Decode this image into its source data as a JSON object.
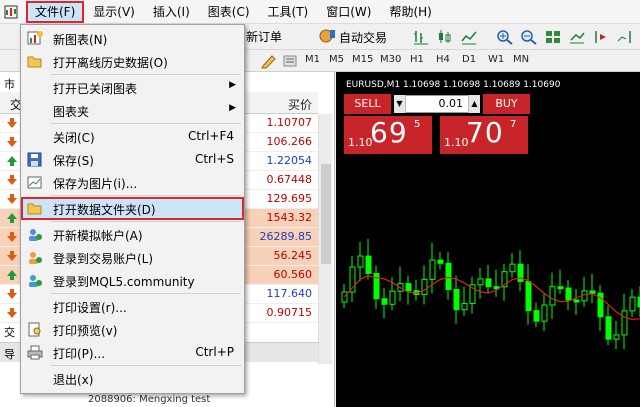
{
  "menubar": {
    "items": [
      "文件(F)",
      "显示(V)",
      "插入(I)",
      "图表(C)",
      "工具(T)",
      "窗口(W)",
      "帮助(H)"
    ]
  },
  "toolbar": {
    "new_order": "新订单",
    "auto_trading": "自动交易"
  },
  "timeframes": [
    "M1",
    "M5",
    "M15",
    "M30",
    "H1",
    "H4",
    "D1",
    "W1",
    "MN"
  ],
  "market_watch": {
    "title_fragment": "市",
    "col_fragment": "交",
    "price_header": "买价",
    "rows": [
      {
        "value": "1.10707",
        "color": "#c00000",
        "bg": "#ffffff"
      },
      {
        "value": "106.266",
        "color": "#c00000",
        "bg": "#ffffff"
      },
      {
        "value": "1.22054",
        "color": "#1f3dbf",
        "bg": "#ffffff"
      },
      {
        "value": "0.67448",
        "color": "#c00000",
        "bg": "#ffffff"
      },
      {
        "value": "129.695",
        "color": "#c00000",
        "bg": "#ffffff"
      },
      {
        "value": "1543.32",
        "color": "#c00000",
        "bg": "#f7d1b8"
      },
      {
        "value": "26289.85",
        "color": "#1f3dbf",
        "bg": "#f7d1b8"
      },
      {
        "value": "56.245",
        "color": "#c00000",
        "bg": "#f7d1b8"
      },
      {
        "value": "60.560",
        "color": "#c00000",
        "bg": "#f7d1b8"
      },
      {
        "value": "117.640",
        "color": "#1f3dbf",
        "bg": "#ffffff"
      },
      {
        "value": "0.90715",
        "color": "#c00000",
        "bg": "#ffffff"
      }
    ],
    "navigator_fragment": "导",
    "tab_fragment": "交",
    "account_item": "2088906: Mengxing test"
  },
  "chart": {
    "title": "EURUSD,M1  1.10698 1.10698 1.10689 1.10690",
    "sell_label": "SELL",
    "buy_label": "BUY",
    "lot": "0.01",
    "sell_quote": {
      "prefix": "1.10",
      "big": "69",
      "sup": "5"
    },
    "buy_quote": {
      "prefix": "1.10",
      "big": "70",
      "sup": "7"
    }
  },
  "file_menu": {
    "items": [
      {
        "label": "新图表(N)",
        "shortcut": "",
        "submenu": false,
        "icon": "new-chart-icon"
      },
      {
        "label": "打开离线历史数据(O)",
        "shortcut": "",
        "submenu": false,
        "icon": "open-folder-icon"
      },
      {
        "label": "打开已关闭图表",
        "shortcut": "",
        "submenu": true,
        "icon": ""
      },
      {
        "label": "图表夹",
        "shortcut": "",
        "submenu": true,
        "icon": ""
      },
      {
        "label": "关闭(C)",
        "shortcut": "Ctrl+F4",
        "submenu": false,
        "icon": ""
      },
      {
        "label": "保存(S)",
        "shortcut": "Ctrl+S",
        "submenu": false,
        "icon": "save-icon"
      },
      {
        "label": "保存为图片(i)...",
        "shortcut": "",
        "submenu": false,
        "icon": "save-image-icon"
      },
      {
        "label": "打开数据文件夹(D)",
        "shortcut": "",
        "submenu": false,
        "icon": "data-folder-icon"
      },
      {
        "label": "开新模拟帐户(A)",
        "shortcut": "",
        "submenu": false,
        "icon": "new-account-icon"
      },
      {
        "label": "登录到交易账户(L)",
        "shortcut": "",
        "submenu": false,
        "icon": "login-icon"
      },
      {
        "label": "登录到MQL5.community",
        "shortcut": "",
        "submenu": false,
        "icon": "mql5-login-icon"
      },
      {
        "label": "打印设置(r)...",
        "shortcut": "",
        "submenu": false,
        "icon": ""
      },
      {
        "label": "打印预览(v)",
        "shortcut": "",
        "submenu": false,
        "icon": "print-preview-icon"
      },
      {
        "label": "打印(P)...",
        "shortcut": "Ctrl+P",
        "submenu": false,
        "icon": "print-icon"
      },
      {
        "label": "退出(x)",
        "shortcut": "",
        "submenu": false,
        "icon": ""
      }
    ]
  },
  "colors": {
    "highlight_border": "#e1252a",
    "highlight_fill": "#cce4f7",
    "trade_red": "#c8252a",
    "bull_candle": "#00ff00",
    "ma_line": "#e02020"
  }
}
